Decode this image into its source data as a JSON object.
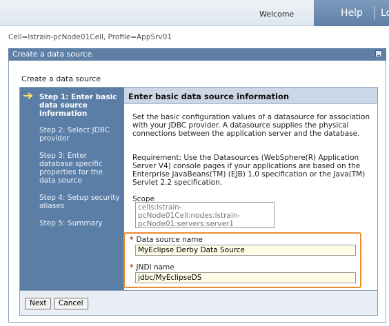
{
  "header": {
    "welcome": "Welcome",
    "help": "Help",
    "logout": "Lo"
  },
  "context_line": "Cell=lstrain-pcNode01Cell, Profile=AppSrv01",
  "panel": {
    "title": "Create a data source"
  },
  "wizard": {
    "title": "Create a data source",
    "steps": [
      {
        "label": "Step 1: Enter basic data source information"
      },
      {
        "label": "Step 2: Select JDBC provider"
      },
      {
        "label": "Step 3: Enter database specific properties for the data source"
      },
      {
        "label": "Step 4: Setup security aliases"
      },
      {
        "label": "Step 5: Summary"
      }
    ],
    "heading": "Enter basic data source information",
    "description": "Set the basic configuration values of a datasource for association with your JDBC provider. A datasource supplies the physical connections between the application server and the database.",
    "requirement": "Requirement: Use the Datasources (WebSphere(R) Application Server V4) console pages if your applications are based on the Enterprise JavaBeans(TM) (EJB) 1.0 specification or the Java(TM) Servlet 2.2 specification.",
    "scope_label": "Scope",
    "scope_value": "cells:lstrain-pcNode01Cell:nodes:lstrain-pcNode01:servers:server1",
    "fields": {
      "datasource_name": {
        "label": "Data source name",
        "value": "MyEclipse Derby Data Source"
      },
      "jndi_name": {
        "label": "JNDI name",
        "value": "jdbc/MyEclipseDS"
      }
    },
    "required_marker": "*",
    "buttons": {
      "next": "Next",
      "cancel": "Cancel"
    }
  },
  "colors": {
    "step_panel": "#5b7ea7",
    "highlight": "#f08a2a",
    "accent_arrow": "#ffe36a"
  }
}
